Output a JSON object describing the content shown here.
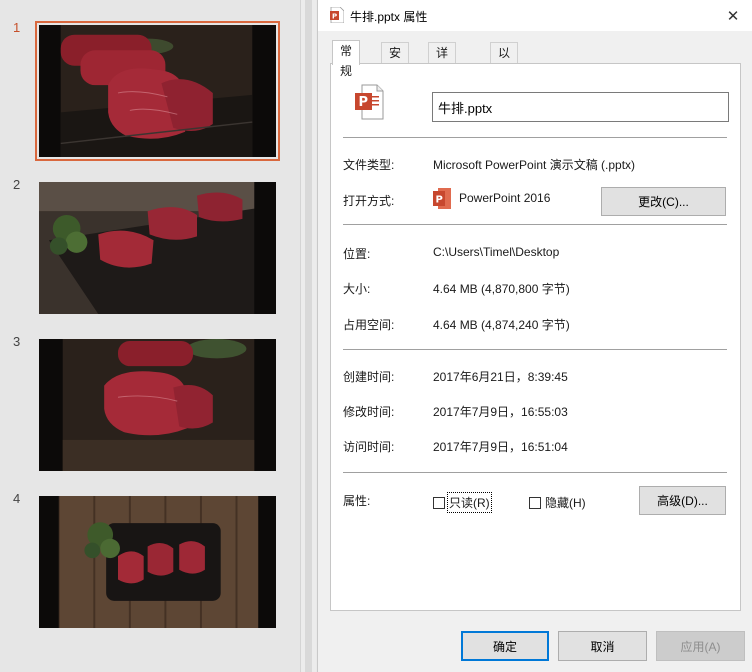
{
  "slides": [
    {
      "number": "1",
      "active": true
    },
    {
      "number": "2",
      "active": false
    },
    {
      "number": "3",
      "active": false
    },
    {
      "number": "4",
      "active": false
    }
  ],
  "dialog": {
    "title": "牛排.pptx 属性",
    "close_label": "✕",
    "tabs": [
      "常规",
      "安全",
      "详细信息",
      "以前的版本"
    ],
    "active_tab": "常规",
    "general": {
      "file_name": "牛排.pptx",
      "file_type_label": "文件类型:",
      "file_type_value": "Microsoft PowerPoint 演示文稿 (.pptx)",
      "opens_with_label": "打开方式:",
      "opens_with_value": "PowerPoint 2016",
      "change_button": "更改(C)...",
      "location_label": "位置:",
      "location_value": "C:\\Users\\Timel\\Desktop",
      "size_label": "大小:",
      "size_value": "4.64 MB (4,870,800 字节)",
      "disk_size_label": "占用空间:",
      "disk_size_value": "4.64 MB (4,874,240 字节)",
      "created_label": "创建时间:",
      "created_value": "2017年6月21日，8:39:45",
      "modified_label": "修改时间:",
      "modified_value": "2017年7月9日，16:55:03",
      "accessed_label": "访问时间:",
      "accessed_value": "2017年7月9日，16:51:04",
      "attributes_label": "属性:",
      "readonly_label": "只读(R)",
      "readonly_checked": false,
      "hidden_label": "隐藏(H)",
      "hidden_checked": false,
      "advanced_button": "高级(D)..."
    },
    "footer": {
      "ok_button": "确定",
      "cancel_button": "取消",
      "apply_button": "应用(A)"
    }
  },
  "colors": {
    "accent_selection": "#d9683e",
    "powerpoint_red": "#c7472e",
    "focus_blue": "#0078d7"
  }
}
